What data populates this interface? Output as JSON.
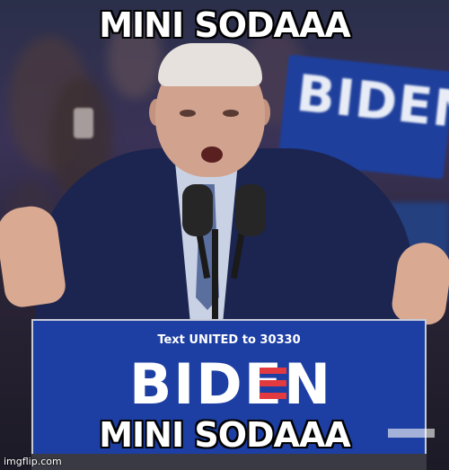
{
  "meme": {
    "top_caption": "MINI SODAAA",
    "bottom_caption": "MINI SODAAA",
    "watermark": "imgflip.com"
  },
  "podium": {
    "text_line": "Text UNITED to 30330",
    "logo": "BIDEN"
  },
  "background_sign": {
    "text": "BIDEN"
  },
  "colors": {
    "podium_blue": "#1d3fa3",
    "accent_red": "#e23a3f",
    "caption_text": "#ffffff",
    "caption_outline": "#000000"
  }
}
